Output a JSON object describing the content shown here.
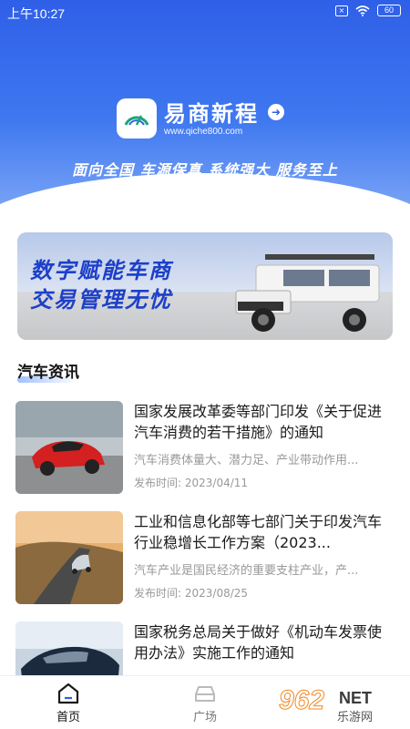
{
  "status_bar": {
    "time": "上午10:27",
    "battery": "60"
  },
  "header": {
    "brand_name": "易商新程",
    "brand_url": "www.qiche800.com",
    "slogan": "面向全国  车源保真  系统强大  服务至上"
  },
  "banner": {
    "line1": "数字赋能车商",
    "line2": "交易管理无忧"
  },
  "section": {
    "title": "汽车资讯"
  },
  "news": [
    {
      "title": "国家发展改革委等部门印发《关于促进汽车消费的若干措施》的通知",
      "summary": "汽车消费体量大、潜力足、产业带动作用...",
      "date": "发布时间: 2023/04/11"
    },
    {
      "title": "工业和信息化部等七部门关于印发汽车行业稳增长工作方案（2023...",
      "summary": "汽车产业是国民经济的重要支柱产业，产...",
      "date": "发布时间: 2023/08/25"
    },
    {
      "title": "国家税务总局关于做好《机动车发票使用办法》实施工作的通知",
      "summary": "",
      "date": ""
    }
  ],
  "nav": {
    "home": "首页",
    "plaza": "广场"
  },
  "watermark": {
    "num": "962",
    "net": "NET",
    "sub": "乐游网"
  },
  "colors": {
    "primary": "#2f5fe8",
    "banner_text": "#1d3fc9",
    "muted": "#999999"
  }
}
